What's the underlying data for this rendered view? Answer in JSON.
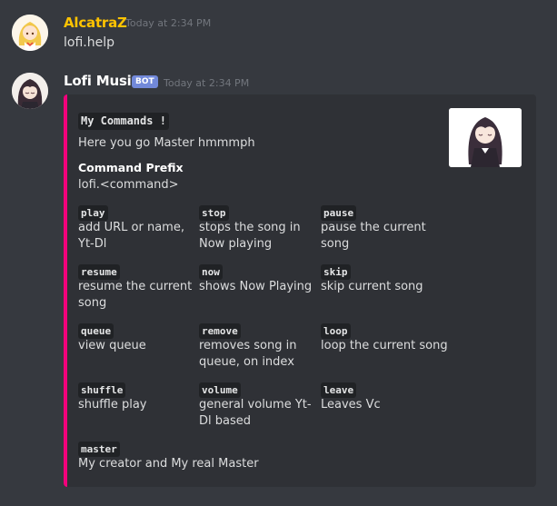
{
  "messages": [
    {
      "username": "AlcatraZ",
      "username_color": "#ffc300",
      "timestamp": "Today at 2:34 PM",
      "content": "lofi.help"
    },
    {
      "username": "Lofi Music",
      "username_color": "#ffffff",
      "bot_tag": "BOT",
      "timestamp": "Today at 2:34 PM",
      "embed": {
        "accent_color": "#f2007b",
        "title": "My Commands !",
        "description": "Here you go Master hmmmph",
        "prefix_name": "Command Prefix",
        "prefix_value": "lofi.<command>",
        "fields": [
          {
            "name": "play",
            "value": "add URL or name, Yt-Dl"
          },
          {
            "name": "stop",
            "value": "stops the song in Now playing"
          },
          {
            "name": "pause",
            "value": "pause the current song"
          },
          {
            "name": "resume",
            "value": "resume the current song"
          },
          {
            "name": "now",
            "value": "shows Now Playing"
          },
          {
            "name": "skip",
            "value": "skip current song"
          },
          {
            "name": "queue",
            "value": "view queue"
          },
          {
            "name": "remove",
            "value": "removes song in queue, on index"
          },
          {
            "name": "loop",
            "value": "loop the current song"
          },
          {
            "name": "shuffle",
            "value": "shuffle play"
          },
          {
            "name": "volume",
            "value": "general volume Yt-Dl based"
          },
          {
            "name": "leave",
            "value": "Leaves Vc"
          },
          {
            "name": "master",
            "value": "My creator and My real Master"
          }
        ]
      }
    }
  ]
}
